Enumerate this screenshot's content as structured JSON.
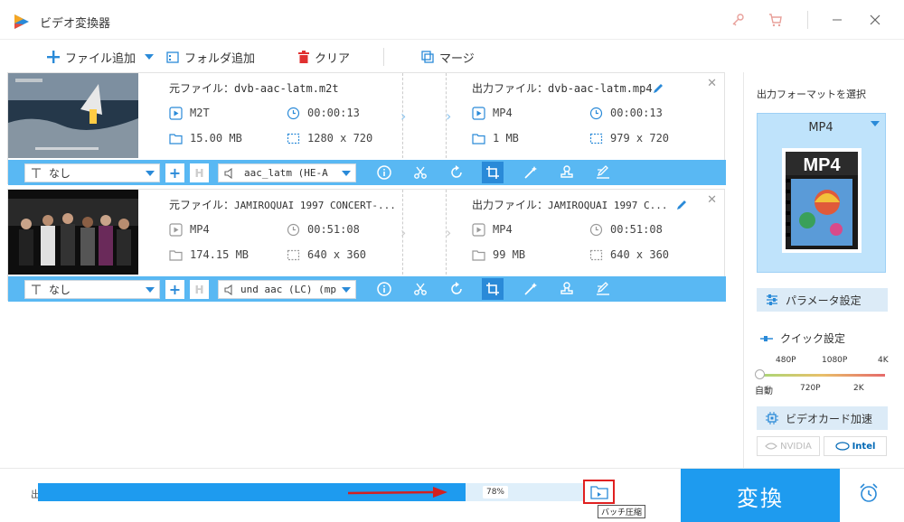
{
  "app": {
    "title": "ビデオ変換器"
  },
  "toolbar": {
    "add_file": "ファイル追加",
    "add_folder": "フォルダ追加",
    "clear": "クリア",
    "merge": "マージ"
  },
  "files": [
    {
      "source_label": "元ファイル：",
      "source_name": "dvb-aac-latm.m2t",
      "source_format": "M2T",
      "source_duration": "00:00:13",
      "source_size": "15.00 MB",
      "source_resolution": "1280 x 720",
      "output_label": "出力ファイル：",
      "output_name": "dvb-aac-latm.mp4",
      "output_format": "MP4",
      "output_duration": "00:00:13",
      "output_size": "1 MB",
      "output_resolution": "979 x 720",
      "subtitle": "なし",
      "audio": "aac_latm (HE-A"
    },
    {
      "source_label": "元ファイル：",
      "source_name": "JAMIROQUAI 1997 CONCERT-...",
      "source_format": "MP4",
      "source_duration": "00:51:08",
      "source_size": "174.15 MB",
      "source_resolution": "640 x 360",
      "output_label": "出力ファイル：",
      "output_name": "JAMIROQUAI 1997 C...",
      "output_format": "MP4",
      "output_duration": "00:51:08",
      "output_size": "99 MB",
      "output_resolution": "640 x 360",
      "subtitle": "なし",
      "audio": "und aac (LC) (mp"
    }
  ],
  "right_panel": {
    "format_label": "出力フォーマットを選択",
    "format_name": "MP4",
    "format_logo_text": "MP4",
    "params_button": "パラメータ設定",
    "quick_title": "クイック設定",
    "quick_top_ticks": [
      "480P",
      "1080P",
      "4K"
    ],
    "quick_bottom_ticks": [
      "自動",
      "720P",
      "2K"
    ],
    "gpu_button": "ビデオカード加速",
    "nvidia": "NVIDIA",
    "intel": "Intel"
  },
  "bottom": {
    "output_label": "出",
    "progress_text": "78%",
    "progress": 0.78,
    "tooltip": "バッチ圧縮",
    "convert_label": "変換"
  },
  "colors": {
    "accent": "#1e9bef",
    "bar": "#59b8f3",
    "highlight": "#e02020"
  }
}
